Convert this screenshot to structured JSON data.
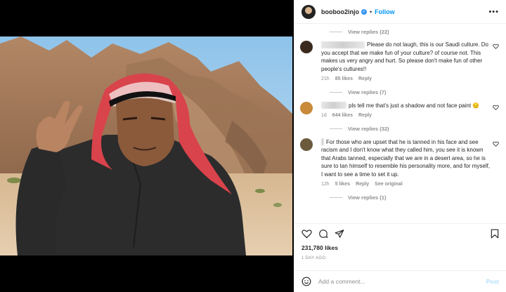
{
  "header": {
    "username": "booboo2injo",
    "separator": "•",
    "follow_label": "Follow",
    "more": "•••"
  },
  "comments": [
    {
      "type": "replies",
      "label": "View replies (22)"
    },
    {
      "type": "comment",
      "avatar_color": "#3a2a1e",
      "name_width": 62,
      "text": "Please do not laugh, this is our Saudi culture. Do you accept that we make fun of your culture? of course not. This makes us very angry and hurt. So please don't make fun of other people's cultures!!",
      "time": "21h",
      "likes": "85 likes",
      "reply": "Reply"
    },
    {
      "type": "replies",
      "label": "View replies (7)"
    },
    {
      "type": "comment",
      "avatar_color": "#c98b3a",
      "name_width": 36,
      "text": "pls tell me that's just a shadow and not face paint 😔",
      "time": "1d",
      "likes": "644 likes",
      "reply": "Reply"
    },
    {
      "type": "replies",
      "label": "View replies (32)"
    },
    {
      "type": "comment",
      "avatar_color": "#6b5a3c",
      "name_width": 4,
      "text": "For those who are upset that he is tanned in his face and see racism and I don't know what they called him, you see it is known that Arabs tanned, especially that we are in a desert area, so he is sure to tan himself to resemble his personality more, and for myself, I want to see a time to set it up.",
      "time": "12h",
      "likes": "5 likes",
      "reply": "Reply",
      "extra": "See original"
    },
    {
      "type": "replies",
      "label": "View replies (1)"
    }
  ],
  "likes": "231,780 likes",
  "date": "1 DAY AGO",
  "add_comment": {
    "placeholder": "Add a comment...",
    "post_label": "Post"
  },
  "nav": {
    "left": "‹",
    "right": "›"
  },
  "colors": {
    "accent": "#0095f6",
    "muted": "#8e8e8e",
    "text": "#262626"
  }
}
